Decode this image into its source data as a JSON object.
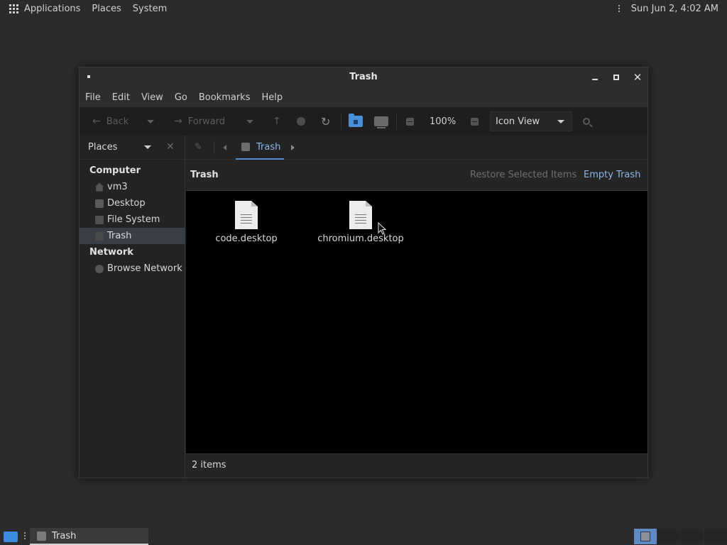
{
  "top_panel": {
    "menus": [
      "Applications",
      "Places",
      "System"
    ],
    "clock": "Sun Jun  2,  4:02 AM"
  },
  "window": {
    "title": "Trash",
    "menu": [
      "File",
      "Edit",
      "View",
      "Go",
      "Bookmarks",
      "Help"
    ],
    "toolbar": {
      "back_label": "Back",
      "forward_label": "Forward",
      "zoom_level": "100%",
      "view_mode": "Icon View"
    },
    "sidebar": {
      "places_label": "Places",
      "sections": [
        {
          "heading": "Computer",
          "items": [
            "vm3",
            "Desktop",
            "File System",
            "Trash"
          ]
        },
        {
          "heading": "Network",
          "items": [
            "Browse Network"
          ]
        }
      ],
      "selected_item": "Trash"
    },
    "pathbar": {
      "crumb": "Trash"
    },
    "trash_bar": {
      "title": "Trash",
      "restore_label": "Restore Selected Items",
      "empty_label": "Empty Trash"
    },
    "files": [
      {
        "name": "code.desktop"
      },
      {
        "name": "chromium.desktop"
      }
    ],
    "status": "2 items"
  },
  "taskbar": {
    "task_label": "Trash"
  },
  "colors": {
    "accent": "#4a90d9",
    "link": "#8fb5e6",
    "selection": "#3a3f47"
  }
}
